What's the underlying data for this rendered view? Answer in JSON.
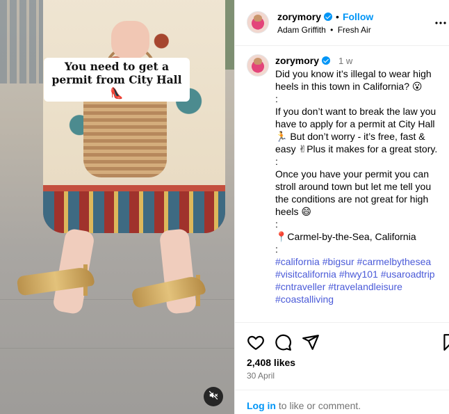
{
  "media": {
    "caption_overlay": "You need to get a permit from City Hall 👠",
    "mute_icon": "volume-muted-icon"
  },
  "header": {
    "username": "zorymory",
    "verified_icon": "verified-badge-icon",
    "dot": "•",
    "follow_label": "Follow",
    "audio_artist": "Adam Griffith",
    "audio_title": "Fresh Air",
    "more_icon": "more-horizontal-icon"
  },
  "comment": {
    "username": "zorymory",
    "time": "1 w",
    "text": "Did you know it’s illegal to wear high heels in this town in California? 😮\n:\nIf you don’t want to break the law you have to apply for a permit at City Hall 🏃 But don’t worry - it’s free, fast & easy ✌Plus it makes for a great story.\n:\nOnce you have your permit you can stroll around town but let me tell you the conditions are not great for high heels 😄\n:\n📍Carmel-by-the-Sea, California\n:",
    "hashtags": [
      "#california",
      "#bigsur",
      "#carmelbythesea",
      "#visitcalifornia",
      "#hwy101",
      "#usaroadtrip",
      "#cntraveller",
      "#travelandleisure",
      "#coastalliving"
    ]
  },
  "actions": {
    "like_icon": "heart-icon",
    "comment_icon": "comment-icon",
    "share_icon": "share-icon",
    "save_icon": "bookmark-icon"
  },
  "likes": "2,408 likes",
  "date": "30 April",
  "footer": {
    "login_label": "Log in",
    "rest": " to like or comment."
  },
  "colors": {
    "accent": "#0095f6",
    "hashtag": "#4a5ad8",
    "muted": "#737373"
  }
}
